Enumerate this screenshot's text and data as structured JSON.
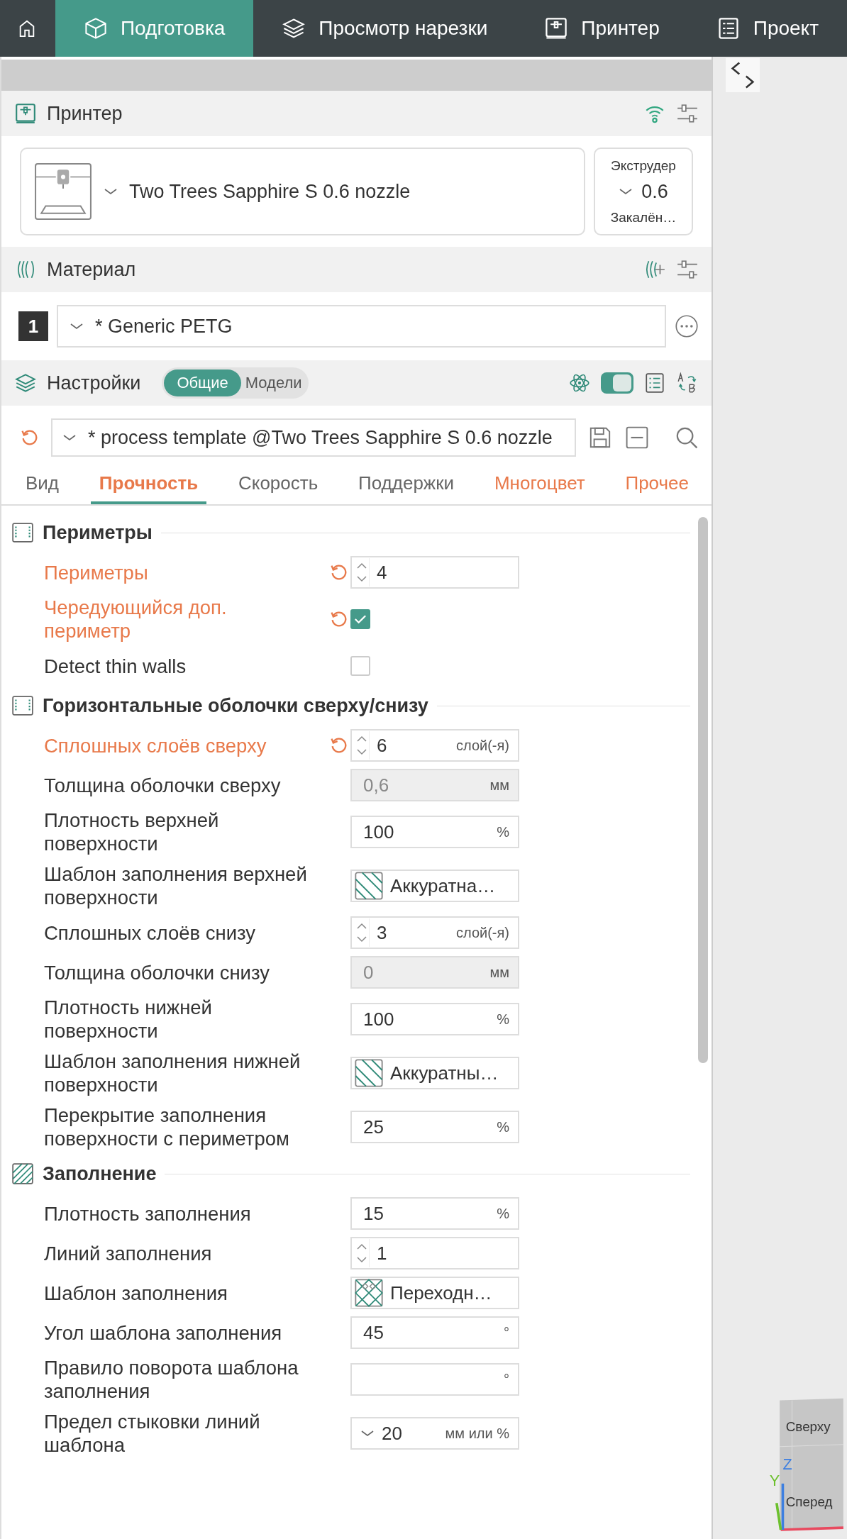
{
  "nav_tabs": [
    {
      "label": "Подготовка",
      "selected": true
    },
    {
      "label": "Просмотр нарезки",
      "selected": false
    },
    {
      "label": "Принтер",
      "selected": false
    },
    {
      "label": "Проект",
      "selected": false
    }
  ],
  "printer": {
    "title": "Принтер",
    "connected": true,
    "name": "Two Trees Sapphire S 0.6 nozzle",
    "extruder": {
      "label": "Экструдер",
      "value": "0.6",
      "type": "Закалён…"
    }
  },
  "material": {
    "title": "Материал",
    "filaments": [
      {
        "index": "1",
        "name": "* Generic PETG"
      }
    ]
  },
  "settings": {
    "title": "Настройки",
    "modes": [
      {
        "label": "Общие",
        "selected": true
      },
      {
        "label": "Модели",
        "selected": false
      }
    ],
    "advanced": true,
    "process": "* process template @Two Trees Sapphire S 0.6 nozzle",
    "tabs": [
      {
        "label": "Вид",
        "selected": false,
        "modified": false
      },
      {
        "label": "Прочность",
        "selected": true,
        "modified": true
      },
      {
        "label": "Скорость",
        "selected": false,
        "modified": false
      },
      {
        "label": "Поддержки",
        "selected": false,
        "modified": false
      },
      {
        "label": "Многоцвет",
        "selected": false,
        "modified": true
      },
      {
        "label": "Прочее",
        "selected": false,
        "modified": true
      }
    ]
  },
  "sections": [
    {
      "title": "Периметры",
      "kind": "shell",
      "rows": [
        {
          "label": "Периметры",
          "modified": true,
          "kind": "spin",
          "value": "4"
        },
        {
          "label": "Чередующийся доп. периметр",
          "modified": true,
          "kind": "check",
          "checked": true
        },
        {
          "label": "Detect thin walls",
          "modified": false,
          "kind": "check",
          "checked": false
        }
      ]
    },
    {
      "title": "Горизонтальные оболочки сверху/снизу",
      "kind": "shell",
      "rows": [
        {
          "label": "Сплошных слоёв сверху",
          "modified": true,
          "kind": "spin",
          "value": "6",
          "unit": "слой(-я)"
        },
        {
          "label": "Толщина оболочки сверху",
          "modified": false,
          "kind": "text",
          "value": "0,6",
          "unit": "мм",
          "disabled": true
        },
        {
          "label": "Плотность верхней поверхности",
          "modified": false,
          "kind": "text",
          "value": "100",
          "unit": "%",
          "disabled": false
        },
        {
          "label": "Шаблон заполнения верхней поверхности",
          "modified": false,
          "kind": "hatched",
          "value": "Аккуратна…"
        },
        {
          "label": "Сплошных слоёв снизу",
          "modified": false,
          "kind": "spin",
          "value": "3",
          "unit": "слой(-я)"
        },
        {
          "label": "Толщина оболочки снизу",
          "modified": false,
          "kind": "text",
          "value": "0",
          "unit": "мм",
          "disabled": true
        },
        {
          "label": "Плотность нижней поверхности",
          "modified": false,
          "kind": "text",
          "value": "100",
          "unit": "%",
          "disabled": false
        },
        {
          "label": "Шаблон заполнения нижней поверхности",
          "modified": false,
          "kind": "hatched",
          "value": "Аккуратны…"
        },
        {
          "label": "Перекрытие заполнения поверхности с периметром",
          "modified": false,
          "kind": "text",
          "value": "25",
          "unit": "%",
          "disabled": false
        }
      ]
    },
    {
      "title": "Заполнение",
      "kind": "infill",
      "rows": [
        {
          "label": "Плотность заполнения",
          "modified": false,
          "kind": "text",
          "value": "15",
          "unit": "%",
          "disabled": false
        },
        {
          "label": "Линий заполнения",
          "modified": false,
          "kind": "spin",
          "value": "1"
        },
        {
          "label": "Шаблон заполнения",
          "modified": false,
          "kind": "crosshatched",
          "value": "Переходн…"
        },
        {
          "label": "Угол шаблона заполнения",
          "modified": false,
          "kind": "text",
          "value": "45",
          "unit": "°",
          "disabled": false
        },
        {
          "label": "Правило поворота шаблона заполнения",
          "modified": false,
          "kind": "text",
          "unit": "°",
          "disabled": false
        },
        {
          "label": "Предел стыковки линий шаблона",
          "modified": false,
          "kind": "combo",
          "value": "20",
          "unit": "мм или %"
        }
      ]
    }
  ],
  "view_cube": {
    "top": "Сверху",
    "z_axis": "Z",
    "y_axis": "Y",
    "front": "Сперед"
  }
}
